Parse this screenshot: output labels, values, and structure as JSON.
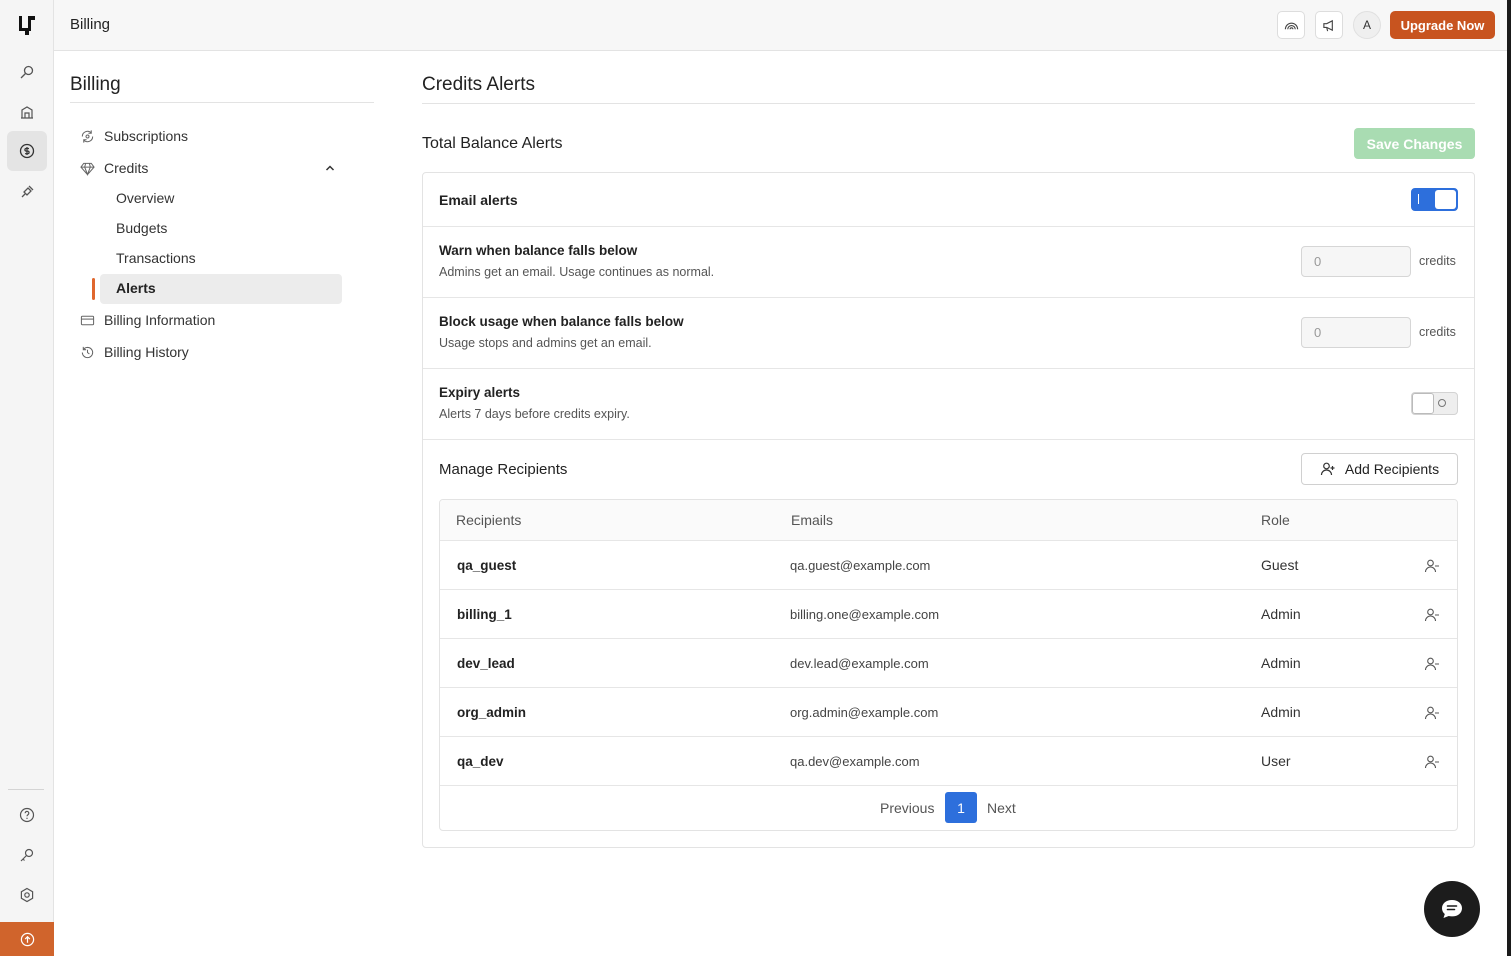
{
  "topbar": {
    "title": "Billing",
    "avatar_initial": "A",
    "upgrade_label": "Upgrade Now",
    "icons": [
      "rainbow-icon",
      "megaphone-icon"
    ]
  },
  "rail": {
    "icons": [
      "logo-icon",
      "search-icon",
      "building-icon",
      "dollar-icon",
      "plug-icon",
      "help-icon",
      "key-icon",
      "settings-icon",
      "upload-icon"
    ],
    "active": "dollar-icon"
  },
  "billing_nav": {
    "title": "Billing",
    "items": [
      {
        "label": "Subscriptions",
        "icon": "refresh-eye-icon"
      },
      {
        "label": "Credits",
        "icon": "diamond-icon",
        "expanded": true
      },
      {
        "label": "Billing Information",
        "icon": "credit-card-icon"
      },
      {
        "label": "Billing History",
        "icon": "history-icon"
      }
    ],
    "credits_sub": [
      "Overview",
      "Budgets",
      "Transactions",
      "Alerts"
    ],
    "active_sub": "Alerts"
  },
  "main": {
    "title": "Credits Alerts",
    "section_title": "Total Balance Alerts",
    "save_label": "Save Changes",
    "email_alerts": {
      "label": "Email alerts",
      "on": true
    },
    "warn": {
      "label": "Warn when balance falls below",
      "desc": "Admins get an email. Usage continues as normal.",
      "value": "0",
      "unit": "credits"
    },
    "block": {
      "label": "Block usage when balance falls below",
      "desc": "Usage stops and admins get an email.",
      "value": "0",
      "unit": "credits"
    },
    "expiry": {
      "label": "Expiry alerts",
      "desc": "Alerts 7 days before credits expiry.",
      "on": false
    },
    "recipients": {
      "title": "Manage Recipients",
      "add_label": "Add Recipients",
      "columns": [
        "Recipients",
        "Emails",
        "Role"
      ],
      "rows": [
        {
          "name": "qa_guest",
          "email": "qa.guest@example.com",
          "role": "Guest"
        },
        {
          "name": "billing_1",
          "email": "billing.one@example.com",
          "role": "Admin"
        },
        {
          "name": "dev_lead",
          "email": "dev.lead@example.com",
          "role": "Admin"
        },
        {
          "name": "org_admin",
          "email": "org.admin@example.com",
          "role": "Admin"
        },
        {
          "name": "qa_dev",
          "email": "qa.dev@example.com",
          "role": "User"
        }
      ],
      "pager": {
        "prev": "Previous",
        "page": "1",
        "next": "Next"
      }
    }
  },
  "colors": {
    "accent": "#c8541f",
    "primary": "#2d6fdc",
    "save_disabled": "#a9dcb2"
  }
}
